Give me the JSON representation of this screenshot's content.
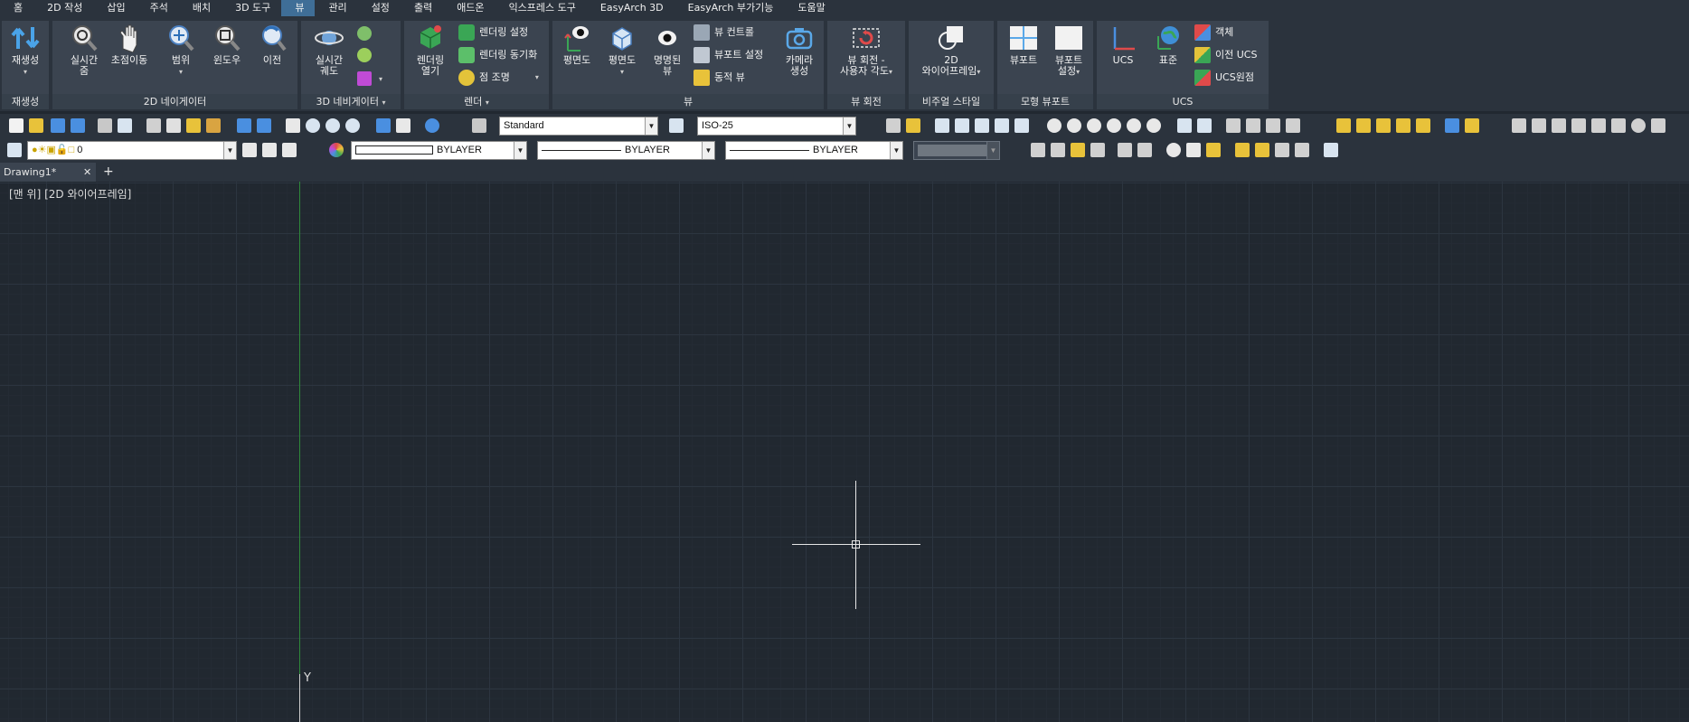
{
  "menu": {
    "tabs": [
      "홈",
      "2D 작성",
      "삽입",
      "주석",
      "배치",
      "3D 도구",
      "뷰",
      "관리",
      "설정",
      "출력",
      "애드온",
      "익스프레스 도구",
      "EasyArch 3D",
      "EasyArch 부가기능",
      "도움말"
    ],
    "active": "뷰"
  },
  "ribbon": {
    "regen": {
      "title": "재생성",
      "button": "재생성"
    },
    "nav2d": {
      "title": "2D 네이게이터",
      "realtime_zoom": "실시간\n줌",
      "pan": "초점이동",
      "extents": "범위",
      "window": "윈도우",
      "previous": "이전"
    },
    "nav3d": {
      "title": "3D 네비게이터",
      "orbit": "실시간\n궤도"
    },
    "render": {
      "title": "렌더",
      "open": "렌더링\n열기",
      "settings": "렌더링 설정",
      "sync": "렌더링 동기화",
      "point_light": "점 조명"
    },
    "view": {
      "title": "뷰",
      "plan": "평면도",
      "elevation": "평면도",
      "named": "명명된\n뷰",
      "view_control": "뷰 컨트롤",
      "viewport_settings": "뷰포트 설정",
      "dynamic_view": "동적 뷰",
      "camera": "카메라\n생성"
    },
    "view_rotate": {
      "title": "뷰 회전",
      "button": "뷰 회전 -\n사용자 각도"
    },
    "visual_style": {
      "title": "비주얼 스타일",
      "button": "2D\n와이어프레임"
    },
    "model_viewport": {
      "title": "모형 뷰포트",
      "viewport": "뷰포트",
      "viewport_settings": "뷰포트\n설정"
    },
    "ucs": {
      "title": "UCS",
      "ucs": "UCS",
      "standard": "표준",
      "object": "객체",
      "previous": "이전 UCS",
      "origin": "UCS원점"
    }
  },
  "toolbar1": {
    "text_style": "Standard",
    "dim_style": "ISO-25"
  },
  "toolbar2": {
    "layer": "0",
    "color": "BYLAYER",
    "linetype": "BYLAYER",
    "lineweight": "BYLAYER"
  },
  "doc": {
    "tab": "Drawing1*",
    "add": "+"
  },
  "canvas": {
    "view_label": "[맨 위] [2D 와이어프레임]",
    "ucs_y": "Y"
  }
}
